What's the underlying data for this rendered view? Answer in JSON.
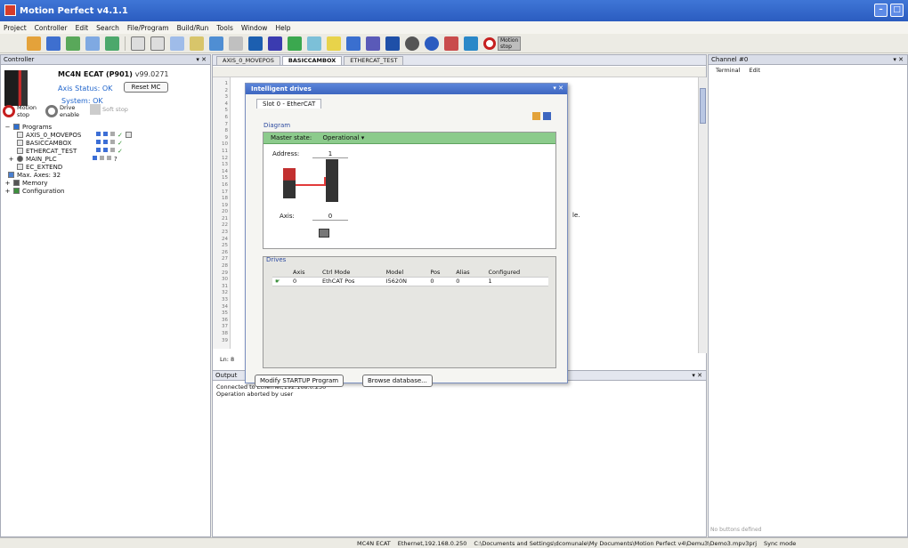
{
  "window": {
    "title": "Motion Perfect v4.1.1"
  },
  "menu": [
    "Project",
    "Controller",
    "Edit",
    "Search",
    "File/Program",
    "Build/Run",
    "Tools",
    "Window",
    "Help"
  ],
  "toolbar": {
    "motion_stop": "Motion stop"
  },
  "controller_panel": {
    "title": "Controller",
    "name": "MC4N ECAT (P901)",
    "version": "v99.0271",
    "axis_status": "Axis Status: OK",
    "reset_button": "Reset MC",
    "system_status": "System: OK",
    "motion_stop": "Motion stop",
    "drive_enable": "Drive enable",
    "soft_stop": "Soft stop"
  },
  "tree": {
    "programs": "Programs",
    "items": [
      "AXIS_0_MOVEPOS",
      "BASICCAMBOX",
      "ETHERCAT_TEST",
      "MAIN_PLC",
      "EC_EXTEND"
    ],
    "max_axes": "Max. Axes: 32",
    "memory": "Memory",
    "configuration": "Configuration"
  },
  "editor": {
    "tabs": [
      "AXIS_0_MOVEPOS",
      "BASICCAMBOX",
      "ETHERCAT_TEST"
    ],
    "active_tab": "BASICCAMBOX",
    "line_numbers": [
      "1",
      "2",
      "3",
      "4",
      "5",
      "6",
      "7",
      "8",
      "9",
      "10",
      "11",
      "12",
      "13",
      "14",
      "15",
      "16",
      "17",
      "18",
      "19",
      "20",
      "21",
      "22",
      "23",
      "24",
      "25",
      "26",
      "27",
      "28",
      "29",
      "30",
      "31",
      "32",
      "33",
      "34",
      "35",
      "36",
      "37",
      "38",
      "39"
    ],
    "code_fragment": "le.",
    "lines_label": "Ln: 8"
  },
  "output_panel": {
    "title": "Output",
    "lines": [
      "Connected to Ethernet,192.168.0.250",
      "Operation aborted by user"
    ]
  },
  "dialog": {
    "title": "Intelligent drives",
    "slot_tab": "Slot 0 - EtherCAT",
    "diagram_label": "Diagram",
    "master_state_label": "Master state:",
    "master_state_value": "Operational",
    "address_label": "Address:",
    "address_value": "1",
    "axis_label": "Axis:",
    "axis_value": "0",
    "drives_label": "Drives",
    "drives_columns": [
      "Axis",
      "Ctrl Mode",
      "Model",
      "Pos",
      "Alias",
      "Configured"
    ],
    "drives_rows": [
      [
        "0",
        "EthCAT Pos",
        "I5620N",
        "0",
        "0",
        "1"
      ]
    ],
    "modify_button": "Modify STARTUP Program",
    "browse_button": "Browse database..."
  },
  "right_panel": {
    "title": "Channel #0",
    "menu": [
      "Terminal",
      "Edit"
    ],
    "footer": "No buttons defined"
  },
  "statusbar": {
    "controller": "MC4N ECAT",
    "connection": "Ethernet,192.168.0.250",
    "path": "C:\\Documents and Settings\\dcomunale\\My Documents\\Motion Perfect v4\\Demu3\\Demo3.mpv3prj",
    "sync": "Sync mode"
  }
}
